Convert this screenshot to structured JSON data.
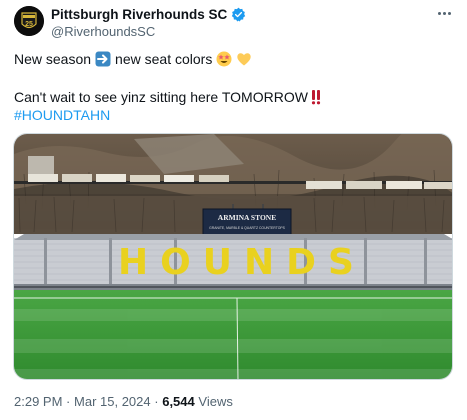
{
  "account": {
    "display_name": "Pittsburgh Riverhounds SC",
    "handle": "@RiverhoundsSC",
    "avatar_text": "25",
    "verified": true
  },
  "tweet": {
    "line1_part1": "New season",
    "line1_part2": "new seat colors",
    "line2": "Can't wait to see yinz sitting here TOMORROW",
    "hashtag": "#HOUNDTAHN",
    "emojis": [
      "right-arrow-emoji",
      "star-struck-emoji",
      "yellow-heart-emoji",
      "double-exclamation-emoji"
    ]
  },
  "photo": {
    "scoreboard_title": "ARMINA STONE",
    "scoreboard_sub": "GRANITE, MARBLE & QUARTZ COUNTERTOPS",
    "seat_letters": "HOUNDS",
    "colors": {
      "seat_yellow": "#e9d11f",
      "seat_gray": "#c9ccd2",
      "grass": "#3e9a3a",
      "scoreboard": "#1c2a44"
    }
  },
  "meta": {
    "time": "2:29 PM",
    "separator": "·",
    "date": "Mar 15, 2024",
    "views_count": "6,544",
    "views_label": "Views"
  },
  "colors": {
    "link_blue": "#1d9bf0",
    "secondary_text": "#536471"
  }
}
